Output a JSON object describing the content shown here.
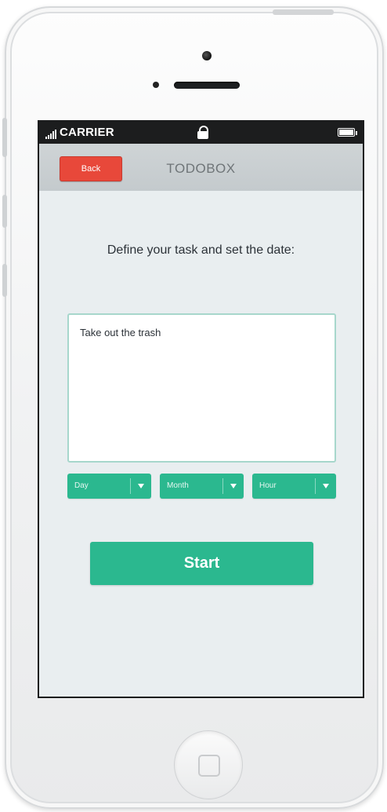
{
  "status_bar": {
    "carrier": "CARRIER",
    "signal_icon": "signal-bars-icon",
    "lock_icon": "lock-icon",
    "battery_icon": "battery-icon"
  },
  "nav": {
    "back_label": "Back",
    "title": "TODOBOX"
  },
  "main": {
    "prompt": "Define your task and set the date:",
    "task_text": "Take out the trash",
    "selects": [
      {
        "label": "Day"
      },
      {
        "label": "Month"
      },
      {
        "label": "Hour"
      }
    ],
    "start_label": "Start"
  },
  "colors": {
    "accent": "#2bb88f",
    "back": "#e8483a",
    "status_bar": "#1c1d1e"
  }
}
